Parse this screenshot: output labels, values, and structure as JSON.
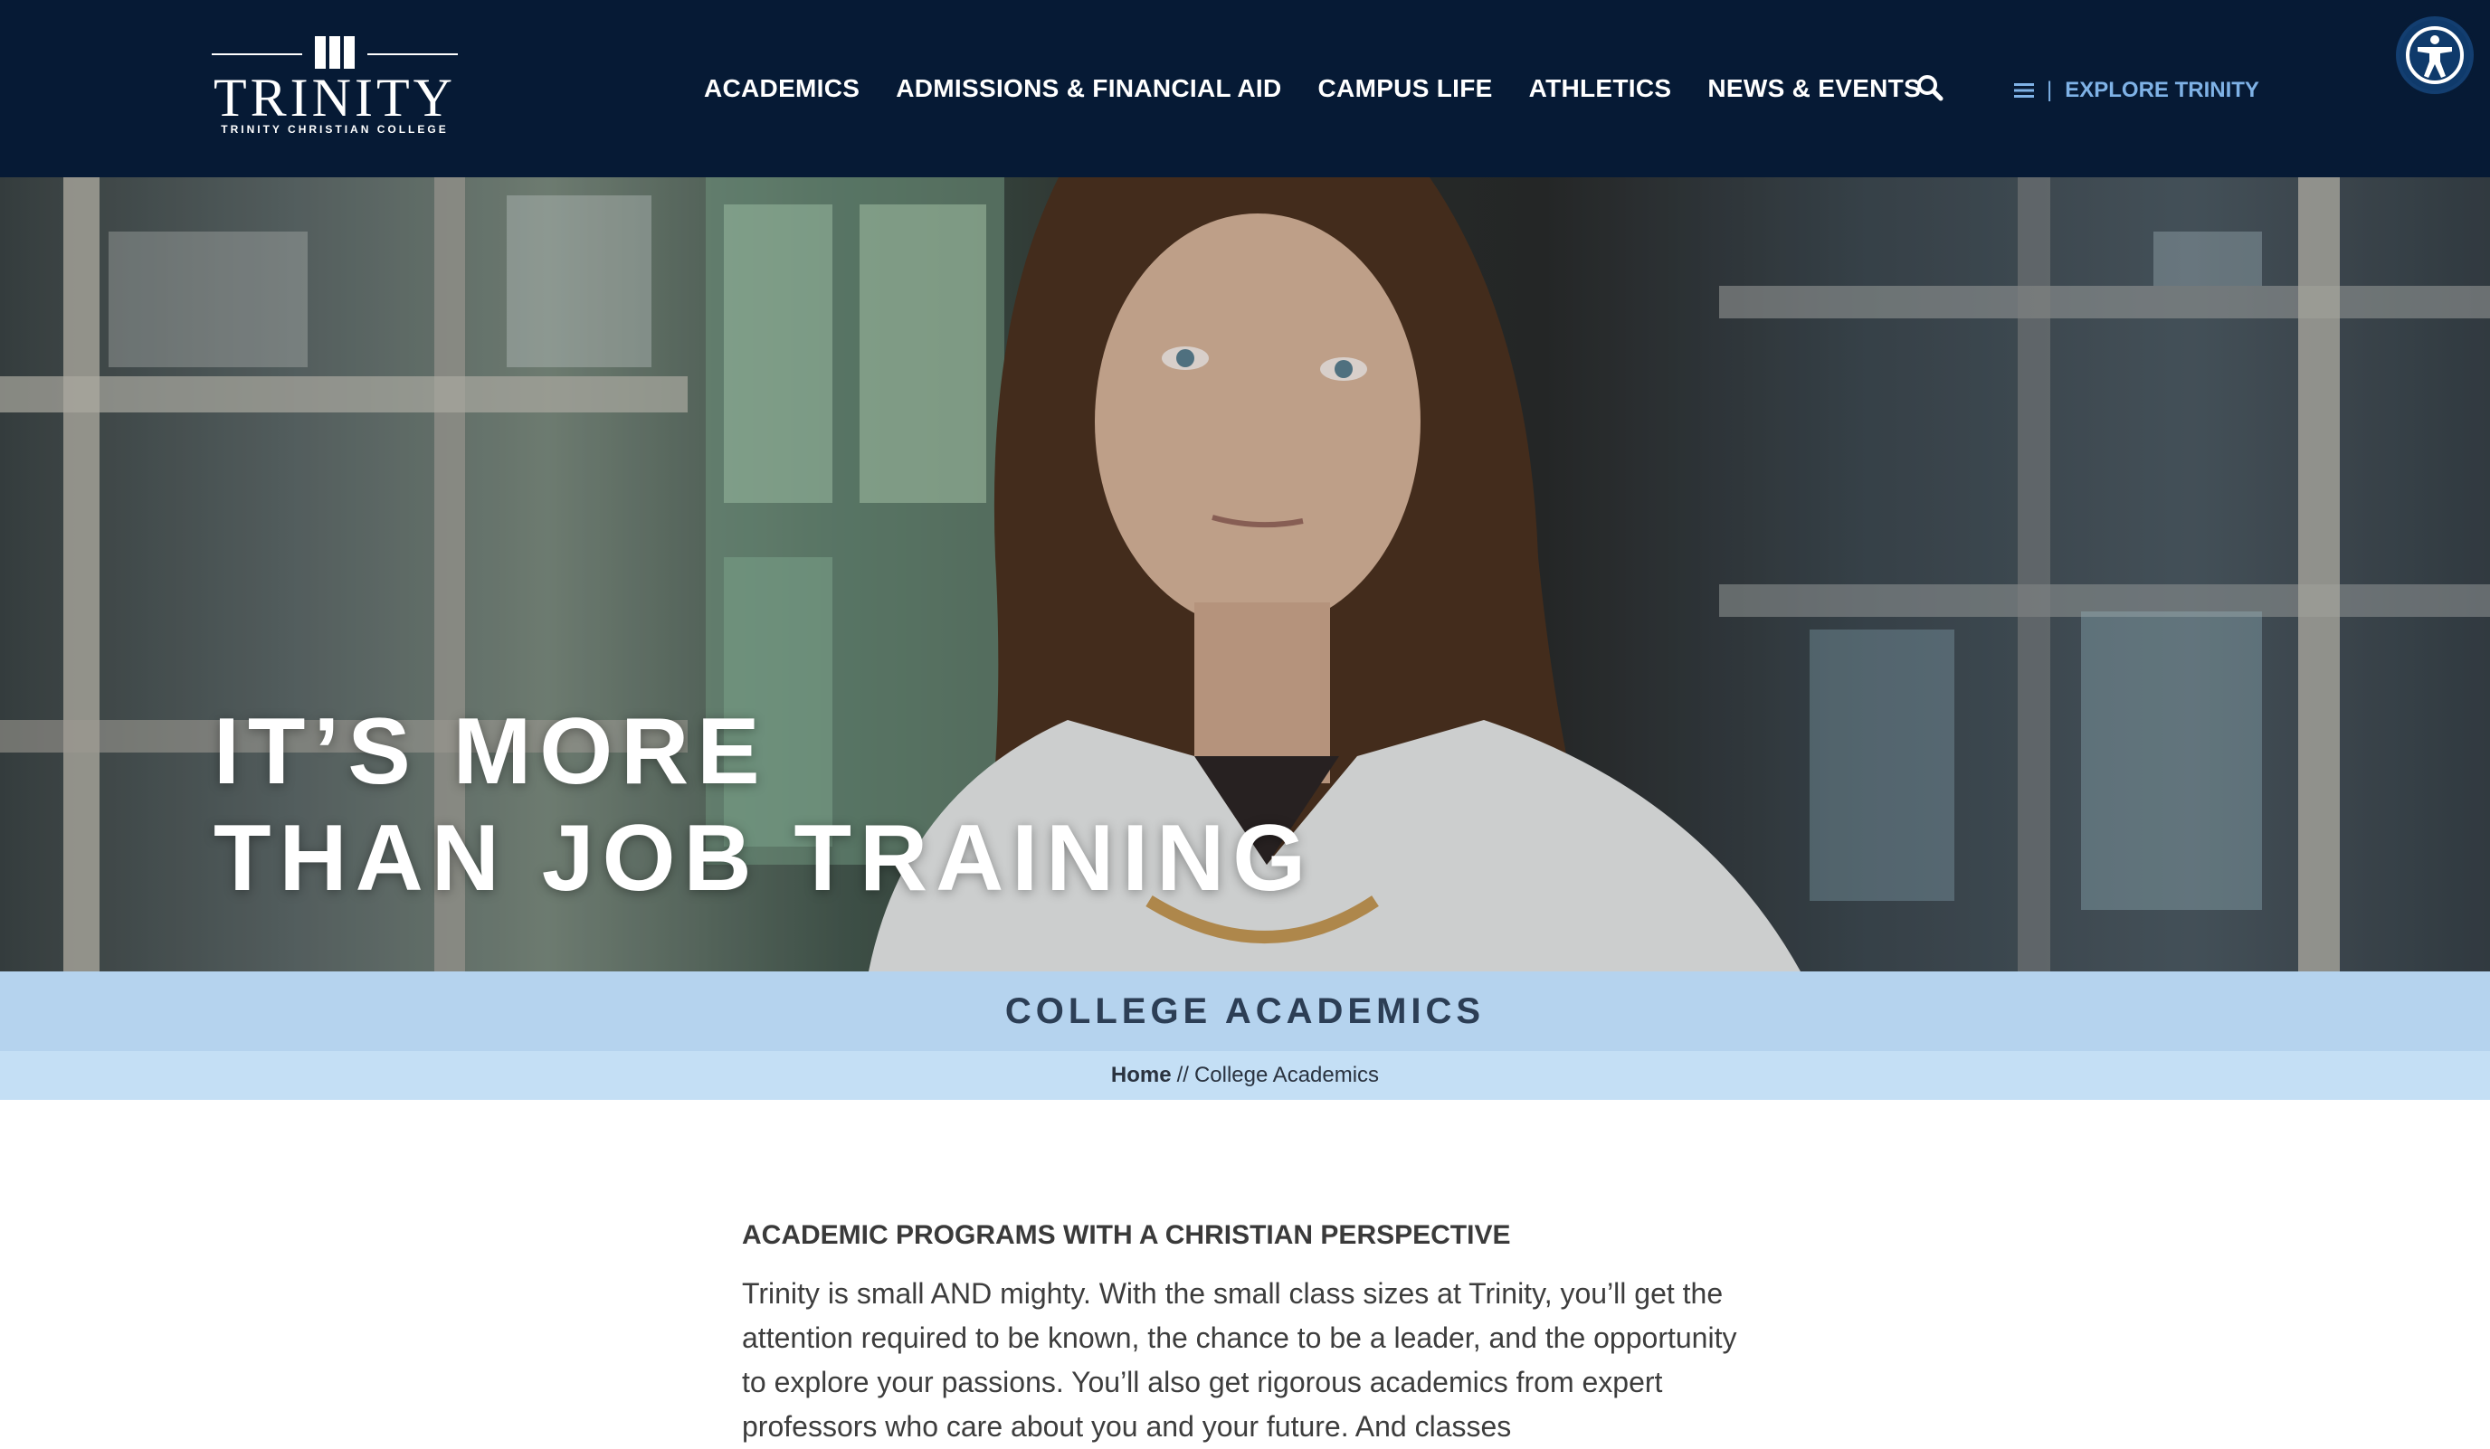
{
  "header": {
    "logo": {
      "wordmark": "TRINITY",
      "subtitle": "TRINITY CHRISTIAN COLLEGE"
    },
    "nav": [
      {
        "label": "ACADEMICS"
      },
      {
        "label": "ADMISSIONS & FINANCIAL AID"
      },
      {
        "label": "CAMPUS LIFE"
      },
      {
        "label": "ATHLETICS"
      },
      {
        "label": "NEWS & EVENTS"
      }
    ],
    "search_icon": "search-icon",
    "explore": {
      "icon": "hamburger-icon",
      "separator": "|",
      "label": "EXPLORE TRINITY"
    },
    "accessibility_icon": "accessibility-icon"
  },
  "hero": {
    "line1": "IT’S MORE",
    "line2": "THAN JOB TRAINING"
  },
  "section": {
    "title": "COLLEGE ACADEMICS"
  },
  "breadcrumb": {
    "home": "Home",
    "divider": "//",
    "current": "College Academics"
  },
  "content": {
    "heading": "ACADEMIC PROGRAMS WITH A CHRISTIAN PERSPECTIVE",
    "paragraph": "Trinity is small AND mighty. With the small class sizes at Trinity, you’ll get the attention required to be known, the chance to be a leader, and the opportunity to explore your passions. You’ll also get rigorous academics from expert professors who care about you and your future. And classes"
  },
  "colors": {
    "header_bg": "#061a35",
    "accent": "#7fb2e6",
    "band": "#afd0ed",
    "breadcrumb_bg": "#c4dff5"
  }
}
